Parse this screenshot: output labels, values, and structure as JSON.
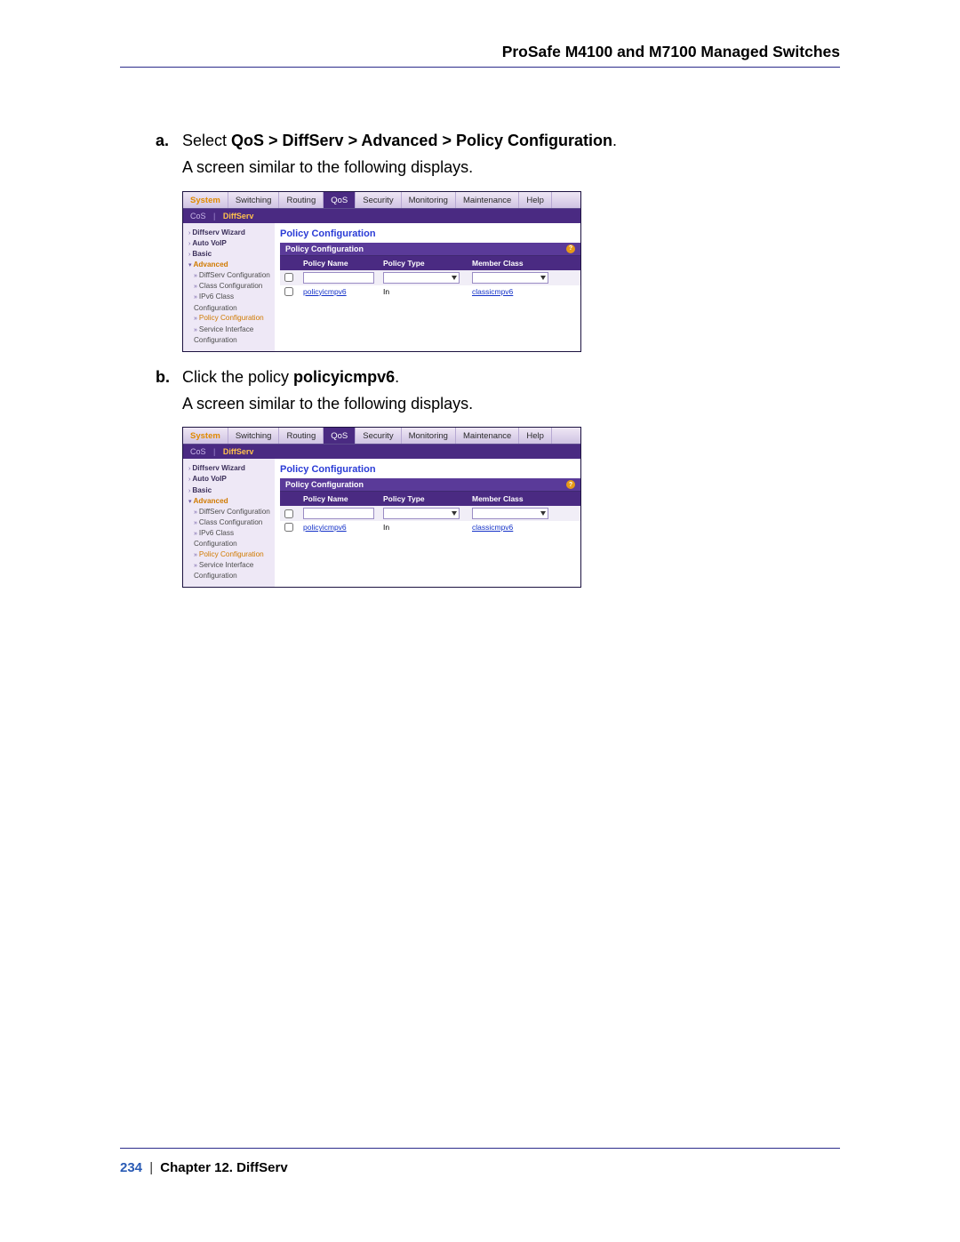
{
  "doc_title": "ProSafe M4100 and M7100 Managed Switches",
  "steps": {
    "a": {
      "marker": "a.",
      "prefix": "Select ",
      "path": "QoS > DiffServ > Advanced > Policy Configuration",
      "suffix": ".",
      "line2": "A screen similar to the following displays."
    },
    "b": {
      "marker": "b.",
      "prefix": "Click the policy ",
      "policy": "policyicmpv6",
      "suffix": ".",
      "line2": "A screen similar to the following displays."
    }
  },
  "tabs": [
    "System",
    "Switching",
    "Routing",
    "QoS",
    "Security",
    "Monitoring",
    "Maintenance",
    "Help"
  ],
  "subtabs": {
    "cos": "CoS",
    "diff": "DiffServ"
  },
  "sidebar": {
    "wizard": "Diffserv Wizard",
    "autovoip": "Auto VoIP",
    "basic": "Basic",
    "advanced": "Advanced",
    "diffserv_cfg": "DiffServ Configuration",
    "class_cfg": "Class Configuration",
    "ipv6_class_cfg": "IPv6 Class Configuration",
    "policy_cfg": "Policy Configuration",
    "svc_if_cfg": "Service Interface Configuration"
  },
  "panel": {
    "title": "Policy Configuration",
    "subtitle": "Policy Configuration",
    "cols": {
      "name": "Policy Name",
      "type": "Policy Type",
      "class": "Member Class"
    },
    "row": {
      "name": "policyicmpv6",
      "type": "In",
      "class": "classicmpv6"
    }
  },
  "footer": {
    "page": "234",
    "chapter": "Chapter 12.  DiffServ"
  }
}
